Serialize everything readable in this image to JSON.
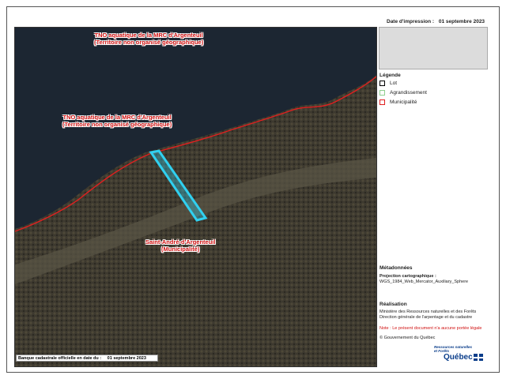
{
  "header": {
    "print_date_label": "Date d'impression :",
    "print_date_value": "01 septembre 2023"
  },
  "map": {
    "labels": [
      {
        "line1": "TNO aquatique de la MRC d'Argenteuil",
        "line2": "(Territoire non organisé géographique)"
      },
      {
        "line1": "TNO aquatique de la MRC d'Argenteuil",
        "line2": "(Territoire non organisé géographique)"
      },
      {
        "line1": "Saint-André-d'Argenteuil",
        "line2": "(Municipalité)"
      }
    ],
    "colors": {
      "water": "#1c2632",
      "land": "#3e3a30",
      "boundary": "#e02020",
      "highlight": "#30d0f0"
    }
  },
  "legend": {
    "title": "Légende",
    "items": [
      {
        "label": "Lot",
        "color": "#000000"
      },
      {
        "label": "Agrandissement",
        "color": "#8fd08f"
      },
      {
        "label": "Municipalité",
        "color": "#e02020"
      }
    ]
  },
  "metadata": {
    "title": "Métadonnées",
    "projection_label": "Projection cartographique :",
    "projection_value": "WGS_1984_Web_Mercator_Auxiliary_Sphere"
  },
  "realisation": {
    "title": "Réalisation",
    "line1": "Ministère des Ressources naturelles et des Forêts",
    "line2": "Direction générale de l'arpentage et du cadastre",
    "note": "Note : Le présent document n'a aucune portée légale",
    "copyright": "© Gouvernement du Québec"
  },
  "logo": {
    "line1": "Ressources naturelles",
    "line2": "et Forêts",
    "name": "Québec"
  },
  "footer": {
    "label": "Banque cadastrale officielle en date du :",
    "value": "01 septembre 2023"
  }
}
